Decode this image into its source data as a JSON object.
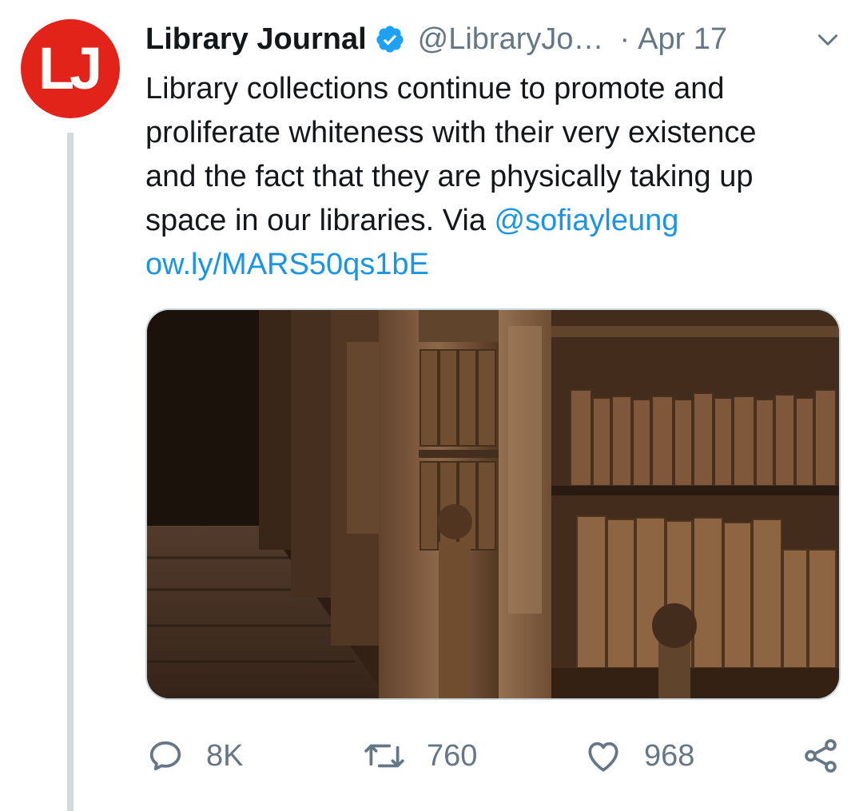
{
  "tweet": {
    "avatar_text": "LJ",
    "display_name": "Library Journal",
    "handle": "@LibraryJo…",
    "separator": "·",
    "date": "Apr 17",
    "text": {
      "line1": "Library collections continue to promote and",
      "line2": "proliferate whiteness with their very existence",
      "line3": "and the fact that they are physically taking up",
      "line4_prefix": "space in our libraries. Via ",
      "mention": "@sofiayleung",
      "url": "ow.ly/MARS50qs1bE"
    },
    "media": {
      "subject": "library-bookshelves-photo"
    },
    "actions": {
      "reply_count": "8K",
      "retweet_count": "760",
      "like_count": "968"
    }
  },
  "icons": {
    "verified": "verified-badge-icon",
    "caret": "chevron-down-icon",
    "reply": "reply-icon",
    "retweet": "retweet-icon",
    "like": "heart-icon",
    "share": "share-icon"
  },
  "colors": {
    "brand_red": "#e2231a",
    "link_blue": "#1b95e0",
    "verified_blue": "#1da1f2",
    "muted_gray": "#657786",
    "thread_line": "#cfd9de"
  }
}
